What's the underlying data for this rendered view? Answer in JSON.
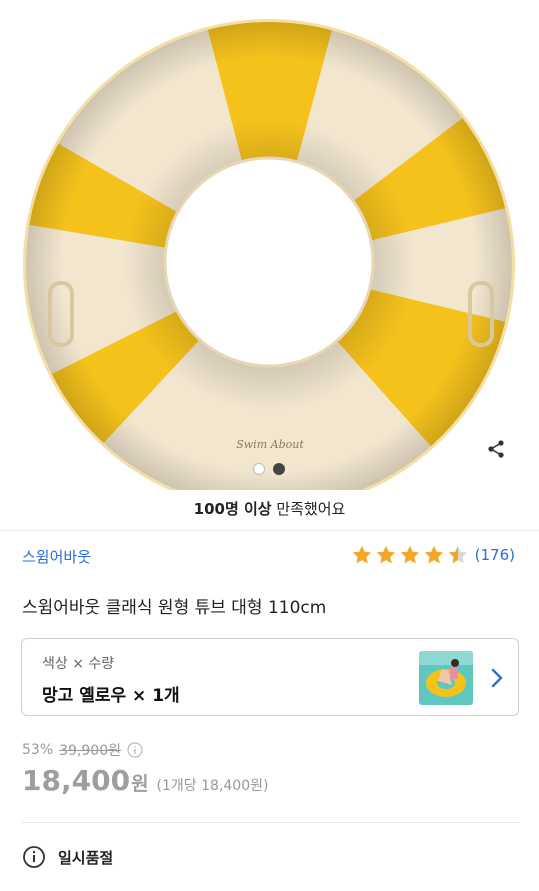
{
  "product_image": {
    "tube_logo_text": "Swim About",
    "primary_color": "#f5c21c",
    "cream_color": "#f2e6cf",
    "carousel": {
      "total": 2,
      "active_index": 1
    }
  },
  "satisfaction": {
    "bold": "100명 이상",
    "rest": " 만족했어요"
  },
  "brand": {
    "name": "스윔어바웃",
    "color": "#2a6fdb"
  },
  "rating": {
    "stars": 4.5,
    "count_label": "(176)",
    "star_color": "#f5a623"
  },
  "product": {
    "title": "스윔어바웃 클래식 원형 튜브 대형 110cm"
  },
  "option": {
    "label": "색상 × 수량",
    "value": "망고 옐로우 × 1개"
  },
  "price": {
    "discount": "53%",
    "original": "39,900원",
    "current": "18,400",
    "currency": "원",
    "per_unit": "(1개당 18,400원)"
  },
  "status": {
    "label": "일시품절"
  },
  "icons": {
    "share": "share-icon",
    "info": "info-icon",
    "chevron": "chevron-right-icon",
    "alert": "info-circle-icon"
  }
}
